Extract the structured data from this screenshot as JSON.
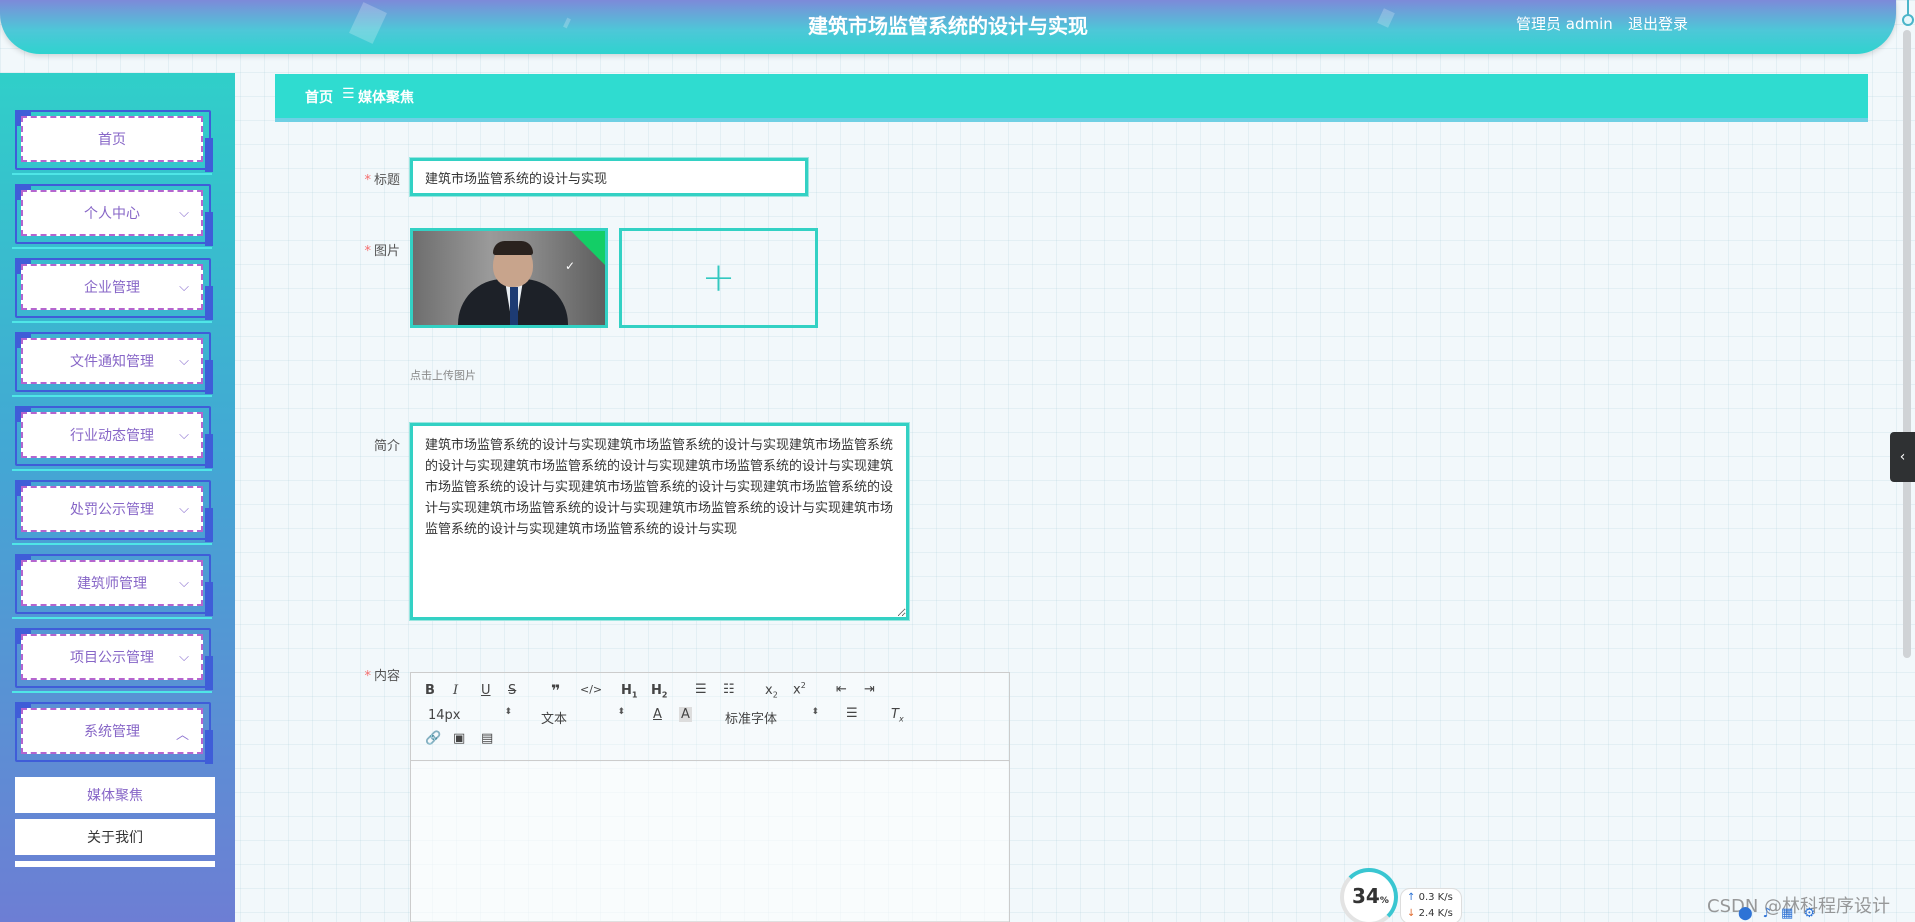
{
  "header": {
    "title": "建筑市场监管系统的设计与实现",
    "user": "管理员 admin",
    "logout": "退出登录"
  },
  "sidebar": {
    "items": [
      {
        "label": "首页"
      },
      {
        "label": "个人中心",
        "chevron": "chevron-down-icon"
      },
      {
        "label": "企业管理",
        "chevron": "chevron-down-icon"
      },
      {
        "label": "文件通知管理",
        "chevron": "chevron-down-icon"
      },
      {
        "label": "行业动态管理",
        "chevron": "chevron-down-icon"
      },
      {
        "label": "处罚公示管理",
        "chevron": "chevron-down-icon"
      },
      {
        "label": "建筑师管理",
        "chevron": "chevron-down-icon"
      },
      {
        "label": "项目公示管理",
        "chevron": "chevron-down-icon"
      },
      {
        "label": "系统管理",
        "chevron": "chevron-up-icon"
      }
    ],
    "sub_items": [
      {
        "label": "媒体聚焦",
        "active": true,
        "color": "#8766c7"
      },
      {
        "label": "关于我们",
        "active": false,
        "color": "#333333"
      }
    ]
  },
  "breadcrumb": {
    "home": "首页",
    "separator": "☰",
    "current": "媒体聚焦"
  },
  "form": {
    "title": {
      "label": "标题",
      "value": "建筑市场监管系统的设计与实现"
    },
    "image": {
      "label": "图片",
      "upload_tip": "点击上传图片"
    },
    "intro": {
      "label": "简介",
      "value": "建筑市场监管系统的设计与实现建筑市场监管系统的设计与实现建筑市场监管系统的设计与实现建筑市场监管系统的设计与实现建筑市场监管系统的设计与实现建筑市场监管系统的设计与实现建筑市场监管系统的设计与实现建筑市场监管系统的设计与实现建筑市场监管系统的设计与实现建筑市场监管系统的设计与实现建筑市场监管系统的设计与实现建筑市场监管系统的设计与实现"
    },
    "content": {
      "label": "内容",
      "font_size": "14px",
      "header_select": "文本",
      "font_family": "标准字体"
    }
  },
  "status": {
    "speed_percent": "34",
    "pct_sign": "%",
    "upload": "0.3 K/s",
    "download": "2.4 K/s",
    "watermark": "CSDN @林科程序设计"
  },
  "colors": {
    "accent": "#33d1c4",
    "menu_text": "#8766c7",
    "required": "#f56c6c"
  }
}
